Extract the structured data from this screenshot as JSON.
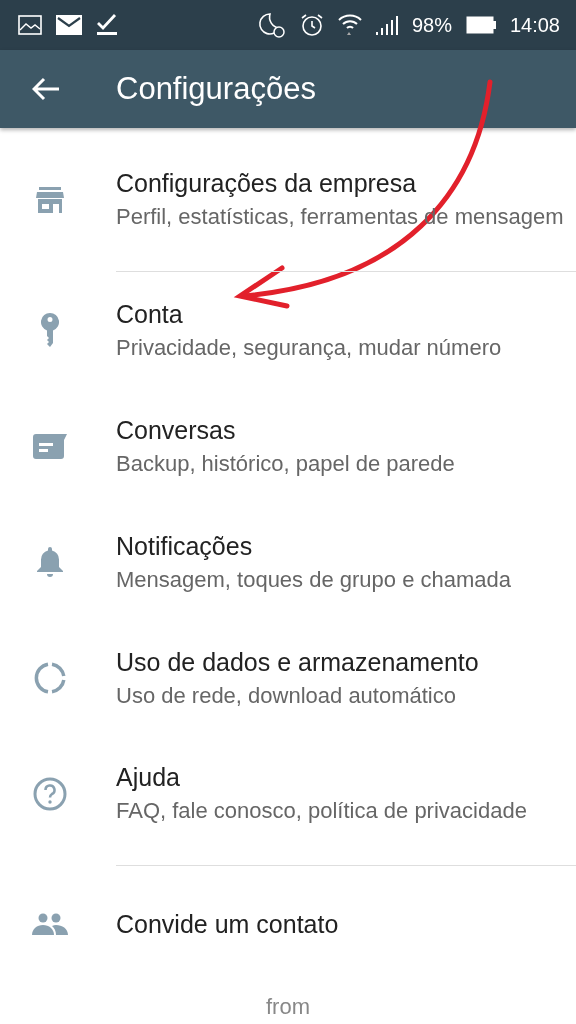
{
  "status_bar": {
    "battery": "98%",
    "time": "14:08"
  },
  "app_bar": {
    "title": "Configurações"
  },
  "items": [
    {
      "kind": "store",
      "title": "Configurações da empresa",
      "subtitle": "Perfil, estatísticas, ferramentas de mensagem",
      "divider": true
    },
    {
      "kind": "key",
      "title": "Conta",
      "subtitle": "Privacidade, segurança, mudar número",
      "divider": false
    },
    {
      "kind": "chat",
      "title": "Conversas",
      "subtitle": "Backup, histórico, papel de parede",
      "divider": false
    },
    {
      "kind": "bell",
      "title": "Notificações",
      "subtitle": "Mensagem, toques de grupo e chamada",
      "divider": false
    },
    {
      "kind": "data",
      "title": "Uso de dados e armazenamento",
      "subtitle": "Uso de rede, download automático",
      "divider": false
    },
    {
      "kind": "help",
      "title": "Ajuda",
      "subtitle": "FAQ, fale conosco, política de privacidade",
      "divider": true
    },
    {
      "kind": "people",
      "title": "Convide um contato",
      "divider": false
    }
  ],
  "footer": "from",
  "annotation": {
    "kind": "arrow"
  }
}
